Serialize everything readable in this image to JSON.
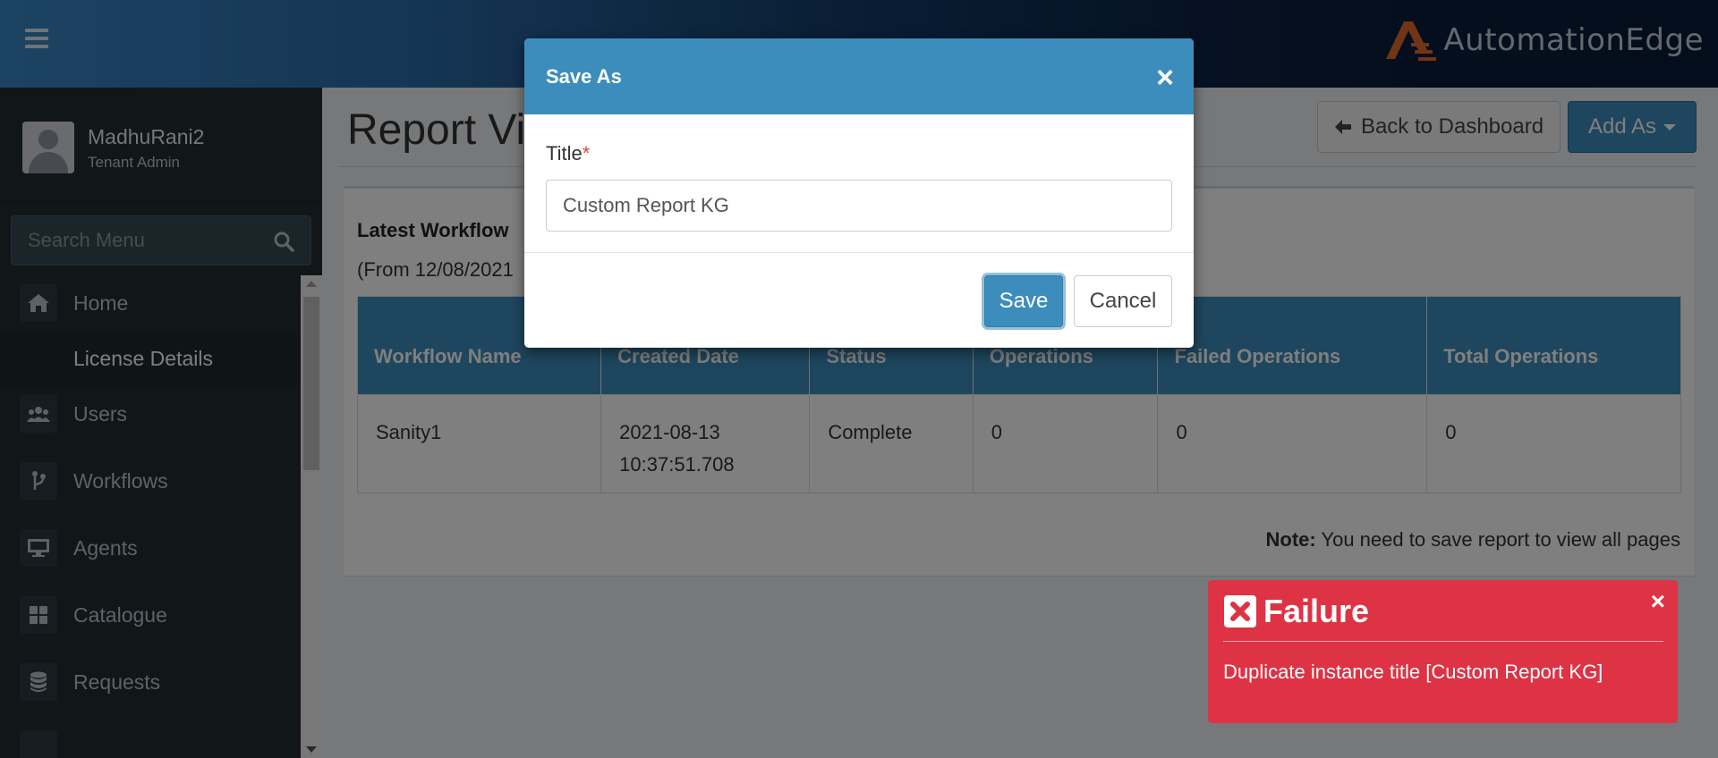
{
  "brand": {
    "name": "AutomationEdge",
    "logo_color": "#e36b2c"
  },
  "user": {
    "name": "MadhuRani2",
    "role": "Tenant Admin"
  },
  "search": {
    "placeholder": "Search Menu",
    "icon": "search-icon"
  },
  "sidebar": {
    "items": [
      {
        "label": "Home",
        "icon": "home-icon"
      },
      {
        "label": "License Details",
        "icon": ""
      },
      {
        "label": "Users",
        "icon": "users-icon"
      },
      {
        "label": "Workflows",
        "icon": "workflow-branch-icon"
      },
      {
        "label": "Agents",
        "icon": "monitor-icon"
      },
      {
        "label": "Catalogue",
        "icon": "grid-icon"
      },
      {
        "label": "Requests",
        "icon": "database-icon"
      }
    ]
  },
  "page": {
    "title": "Report Vi",
    "back_button": "Back to Dashboard",
    "add_as_button": "Add As"
  },
  "report": {
    "heading": "Latest Workflow",
    "subheading": "(From 12/08/2021",
    "columns": [
      "Workflow Name",
      "Created Date",
      "Status",
      "Operations",
      "Failed Operations",
      "Total Operations"
    ],
    "rows": [
      {
        "workflow_name": "Sanity1",
        "created_date_line1": "2021-08-13",
        "created_date_line2": "10:37:51.708",
        "status": "Complete",
        "operations": "0",
        "failed_operations": "0",
        "total_operations": "0"
      }
    ],
    "note_label": "Note:",
    "note_text": " You need to save report to view all pages"
  },
  "modal": {
    "title": "Save As",
    "close": "×",
    "field_label": "Title",
    "required_mark": "*",
    "title_value": "Custom Report KG",
    "save_label": "Save",
    "cancel_label": "Cancel"
  },
  "toast": {
    "title": "Failure",
    "close": "×",
    "message": "Duplicate instance title [Custom Report KG]",
    "color": "#dd3345"
  },
  "colors": {
    "primary": "#3c8dbc",
    "sidebar_bg": "#222d32",
    "danger": "#dd3345"
  }
}
